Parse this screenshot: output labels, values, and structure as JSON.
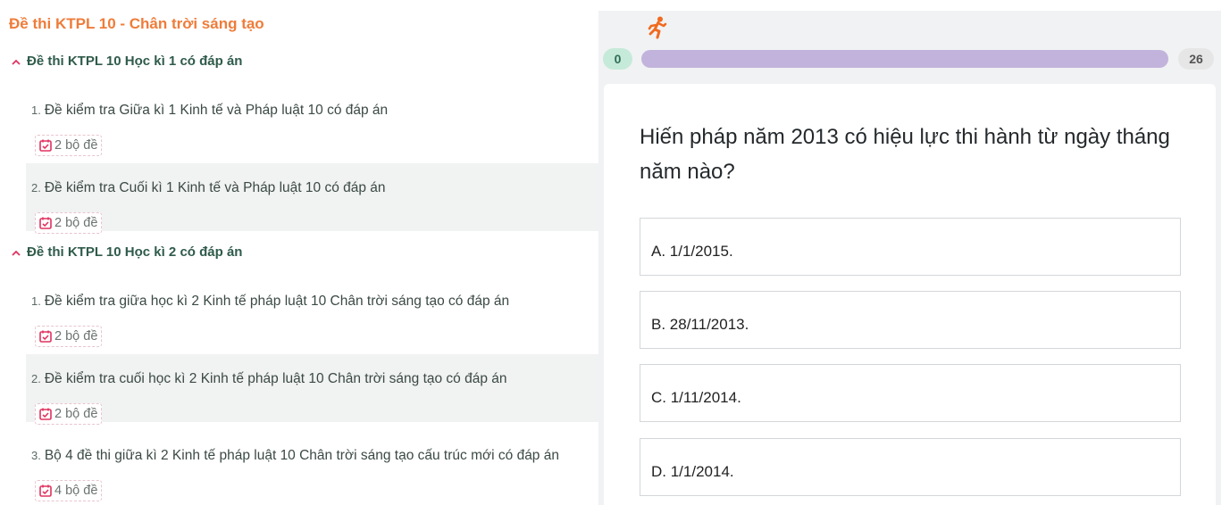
{
  "left": {
    "title": "Đề thi KTPL 10 - Chân trời sáng tạo",
    "sections": [
      {
        "title": "Đề thi KTPL 10 Học kì 1 có đáp án",
        "items": [
          {
            "num": "1.",
            "label": "Đề kiểm tra Giữa kì 1 Kinh tế và Pháp luật 10 có đáp án",
            "badge": "2 bộ đề"
          },
          {
            "num": "2.",
            "label": "Đề kiểm tra Cuối kì 1 Kinh tế và Pháp luật 10 có đáp án",
            "badge": "2 bộ đề"
          }
        ]
      },
      {
        "title": "Đề thi KTPL 10 Học kì 2 có đáp án",
        "items": [
          {
            "num": "1.",
            "label": "Đề kiểm tra giữa học kì 2 Kinh tế pháp luật 10 Chân trời sáng tạo có đáp án",
            "badge": "2 bộ đề"
          },
          {
            "num": "2.",
            "label": "Đề kiểm tra cuối học kì 2 Kinh tế pháp luật 10 Chân trời sáng tạo có đáp án",
            "badge": "2 bộ đề"
          },
          {
            "num": "3.",
            "label": "Bộ 4 đề thi giữa kì 2 Kinh tế pháp luật 10 Chân trời sáng tạo cấu trúc mới có đáp án",
            "badge": "4 bộ đề"
          }
        ]
      }
    ]
  },
  "quiz": {
    "runner_icon": "running-person-icon",
    "progress": {
      "current": "0",
      "total": "26",
      "fraction": 0
    },
    "question": "Hiến pháp năm 2013 có hiệu lực thi hành từ ngày tháng năm nào?",
    "options": [
      {
        "label": "A. 1/1/2015."
      },
      {
        "label": "B. 28/11/2013."
      },
      {
        "label": "C. 1/11/2014."
      },
      {
        "label": "D. 1/1/2014."
      }
    ]
  },
  "colors": {
    "accent": "#ef7c3a",
    "section": "#2f5b4a",
    "progress_track": "#c2b3dc",
    "badge_icon": "#e0325f"
  }
}
